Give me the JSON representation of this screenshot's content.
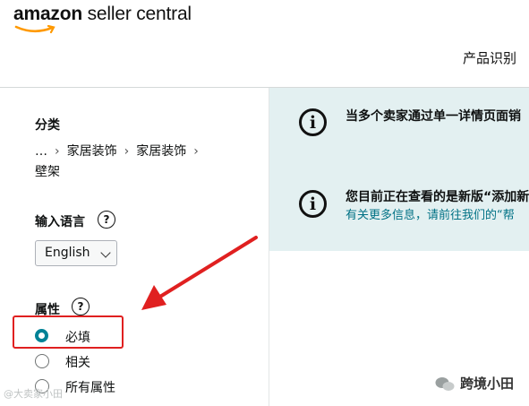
{
  "header": {
    "logo_brand": "amazon",
    "logo_rest": " seller central",
    "nav_link": "产品识别"
  },
  "sidebar": {
    "category_title": "分类",
    "breadcrumb": [
      "…",
      "家居装饰",
      "家居装饰"
    ],
    "breadcrumb_last": "壁架",
    "language_title": "输入语言",
    "language_value": "English",
    "attributes_title": "属性",
    "options": [
      {
        "label": "必填",
        "selected": true
      },
      {
        "label": "相关",
        "selected": false
      },
      {
        "label": "所有属性",
        "selected": false
      }
    ]
  },
  "alerts": [
    {
      "icon": "info-icon",
      "text": "当多个卖家通过单一详情页面销"
    },
    {
      "icon": "info-icon",
      "text": "您目前正在查看的是新版“添加新",
      "sub": "有关更多信息，请前往我们的“帮"
    }
  ],
  "watermark": {
    "left": "@大卖家小田",
    "right": "跨境小田"
  },
  "colors": {
    "accent": "#008296",
    "alert_bg": "#e3f0f1",
    "annotation_red": "#e02020",
    "logo_smile": "#ff9900"
  }
}
